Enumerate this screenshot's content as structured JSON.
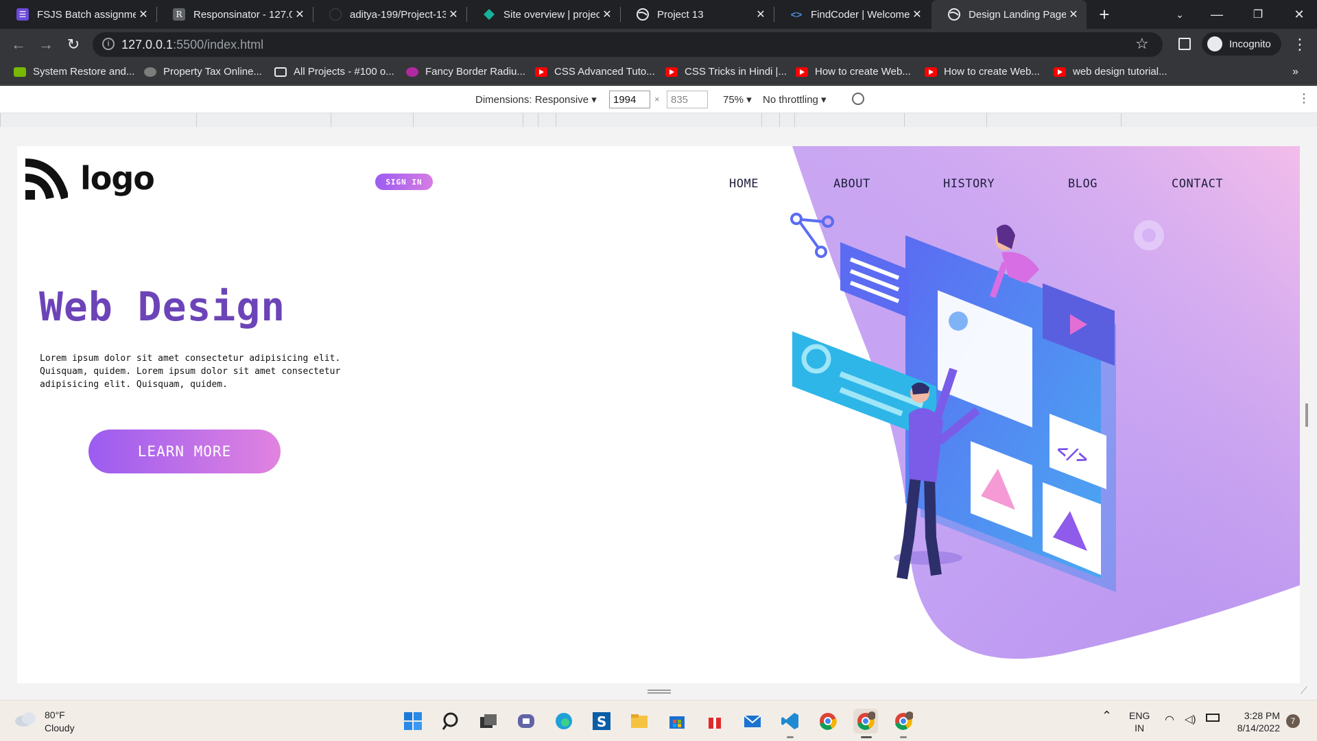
{
  "browser": {
    "tabs": [
      {
        "title": "FSJS Batch assignmen",
        "favicon": "forms-icon",
        "color": "#6a4bd8"
      },
      {
        "title": "Responsinator - 127.0",
        "favicon": "r-icon",
        "color": "#5f6368"
      },
      {
        "title": "aditya-199/Project-13",
        "favicon": "github-icon",
        "color": "#202124"
      },
      {
        "title": "Site overview | project",
        "favicon": "netlify-icon",
        "color": "#17b29b"
      },
      {
        "title": "Project 13",
        "favicon": "globe-icon",
        "color": "#e8eaed"
      },
      {
        "title": "FindCoder | Welcome",
        "favicon": "code-icon",
        "color": "#4a90e2"
      },
      {
        "title": "Design Landing Page",
        "favicon": "globe-icon",
        "color": "#e8eaed",
        "active": true
      }
    ],
    "url_host": "127.0.0.1",
    "url_path": ":5500/index.html",
    "profile_label": "Incognito",
    "bookmarks": [
      {
        "label": "System Restore and...",
        "color": "#76b900"
      },
      {
        "label": "Property Tax Online...",
        "color": "#9e9e9e"
      },
      {
        "label": "All Projects - #100 o...",
        "color": "#e8eaed"
      },
      {
        "label": "Fancy Border Radiu...",
        "color": "#b0299e"
      },
      {
        "label": "CSS Advanced Tuto...",
        "color": "#ff0000"
      },
      {
        "label": "CSS Tricks in Hindi |...",
        "color": "#ff0000"
      },
      {
        "label": "How to create Web...",
        "color": "#ff0000"
      },
      {
        "label": "How to create Web...",
        "color": "#ff0000"
      },
      {
        "label": "web design tutorial...",
        "color": "#ff0000"
      }
    ]
  },
  "devtools": {
    "dimensions_label": "Dimensions: Responsive",
    "width": "1994",
    "height": "835",
    "zoom": "75%",
    "throttling": "No throttling"
  },
  "page": {
    "logo": "logo",
    "signin": "SIGN IN",
    "nav": [
      "HOME",
      "ABOUT",
      "HISTORY",
      "BLOG",
      "CONTACT"
    ],
    "hero_title": "Web Design",
    "hero_text": "Lorem ipsum dolor sit amet consectetur adipisicing elit. Quisquam, quidem. Lorem ipsum dolor sit amet consectetur adipisicing elit. Quisquam, quidem.",
    "cta": "LEARN MORE",
    "colors": {
      "accent": "#6c44b8",
      "gradient_start": "#9b5cf0",
      "gradient_end": "#e183e0"
    }
  },
  "taskbar": {
    "weather_temp": "80°F",
    "weather_desc": "Cloudy",
    "lang_top": "ENG",
    "lang_bottom": "IN",
    "time": "3:28 PM",
    "date": "8/14/2022",
    "notif_count": "7"
  }
}
